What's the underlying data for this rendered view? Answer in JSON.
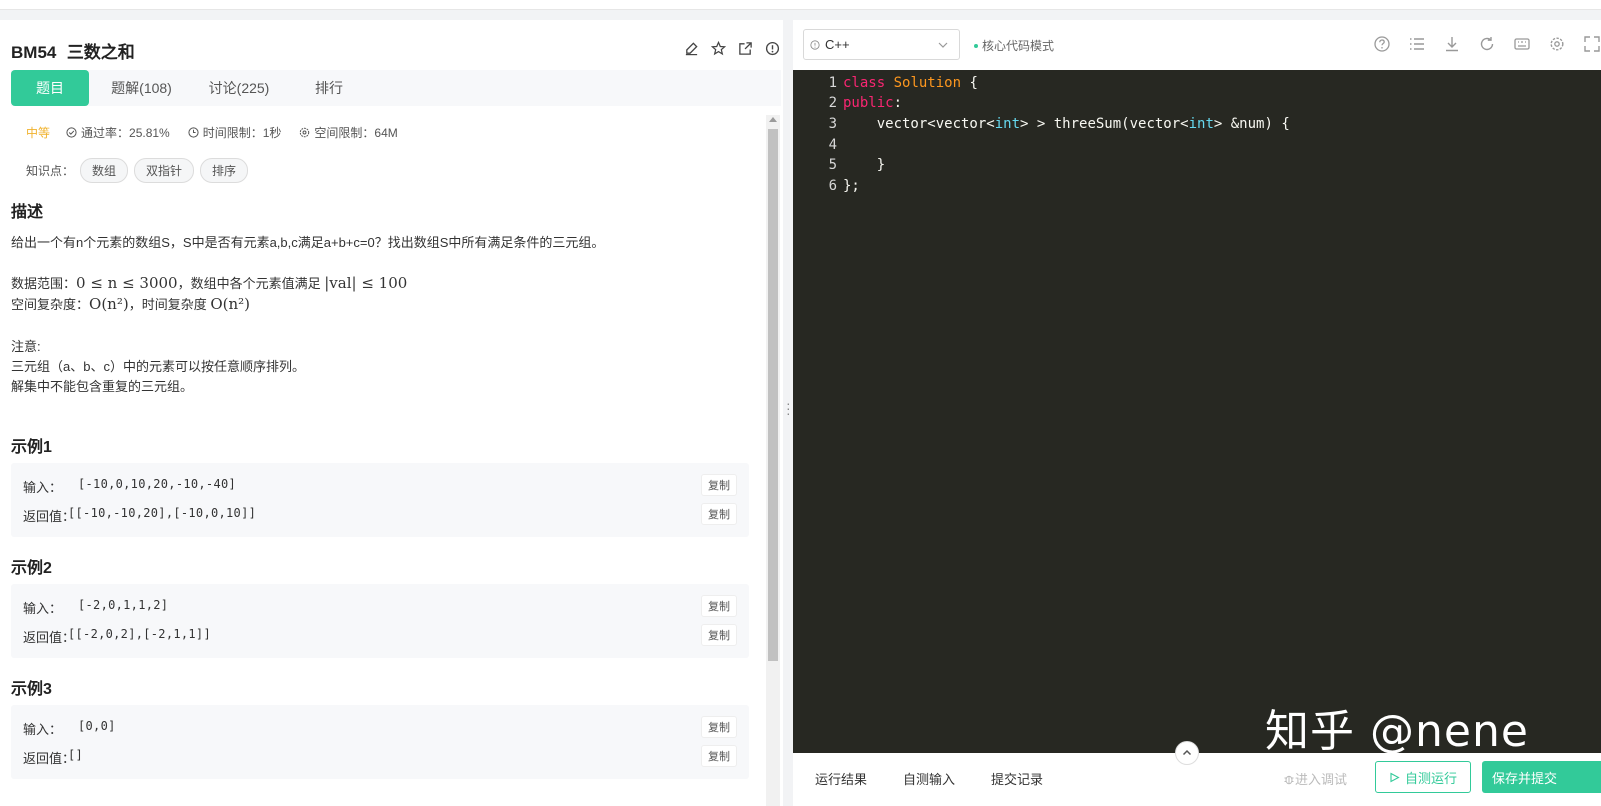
{
  "problem": {
    "id": "BM54",
    "name": "三数之和",
    "tabs": [
      "题目",
      "题解(108)",
      "讨论(225)",
      "排行"
    ],
    "difficulty": "中等",
    "pass_rate": "通过率：25.81%",
    "time_limit": "时间限制：1秒",
    "space_limit": "空间限制：64M",
    "knowledge_label": "知识点：",
    "tags": [
      "数组",
      "双指针",
      "排序"
    ],
    "desc_heading": "描述",
    "desc_line": "给出一个有n个元素的数组S，S中是否有元素a,b,c满足a+b+c=0？找出数组S中所有满足条件的三元组。",
    "range_label": "数据范围：",
    "range_math1": "0 ≤ n ≤ 3000",
    "range_mid": "，数组中各个元素值满足 ",
    "range_math2": "|val| ≤ 100",
    "complex_label": "空间复杂度：",
    "complex_math1": "O(n²)",
    "complex_mid": "，时间复杂度 ",
    "complex_math2": "O(n²)",
    "note_heading": "注意:",
    "note_line1": "三元组（a、b、c）中的元素可以按任意顺序排列。",
    "note_line2": "解集中不能包含重复的三元组。"
  },
  "examples": [
    {
      "title": "示例1",
      "input_label": "输入：",
      "input": "[-10,0,10,20,-10,-40]",
      "output_label": "返回值：",
      "output": "[[-10,-10,20],[-10,0,10]]",
      "copy": "复制"
    },
    {
      "title": "示例2",
      "input_label": "输入：",
      "input": "[-2,0,1,1,2]",
      "output_label": "返回值：",
      "output": "[[-2,0,2],[-2,1,1]]",
      "copy": "复制"
    },
    {
      "title": "示例3",
      "input_label": "输入：",
      "input": "[0,0]",
      "output_label": "返回值：",
      "output": "[]",
      "copy": "复制"
    }
  ],
  "editor": {
    "language": "C++",
    "mode": "核心代码模式",
    "line_numbers": [
      "1",
      "2",
      "3",
      "4",
      "5",
      "6"
    ],
    "line1_kw": "class",
    "line1_cls": "Solution",
    "line1_rest": " {",
    "line2_kw": "public",
    "line2_rest": ":",
    "line3_a": "    vector<vector<",
    "line3_t1": "int",
    "line3_b": "> > threeSum(vector<",
    "line3_t2": "int",
    "line3_c": "> &num) {",
    "line5": "    }",
    "line6": "};"
  },
  "bottom": {
    "tabs": [
      "运行结果",
      "自测输入",
      "提交记录"
    ],
    "debug": "进入调试",
    "selftest": "自测运行",
    "submit": "保存并提交"
  },
  "watermark": "知乎 @nene",
  "colors": {
    "accent": "#32ca99",
    "editor_bg": "#272822",
    "difficulty": "#f0b22c"
  }
}
